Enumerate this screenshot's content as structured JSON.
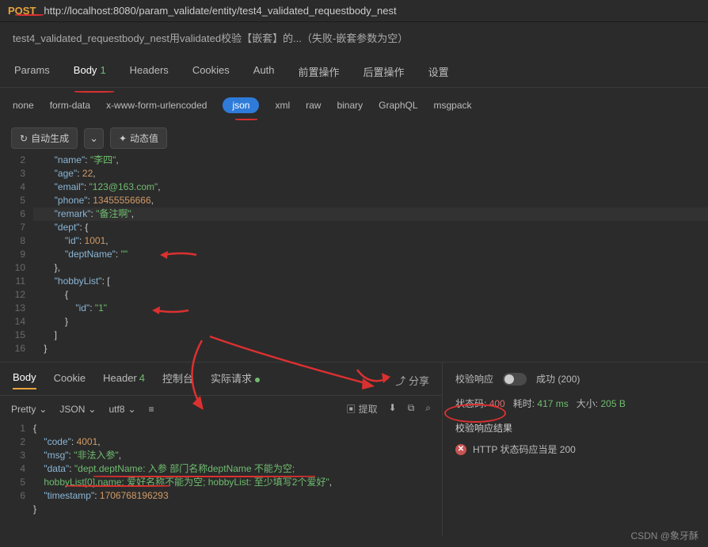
{
  "request": {
    "method": "POST",
    "url": "http://localhost:8080/param_validate/entity/test4_validated_requestbody_nest",
    "description": "test4_validated_requestbody_nest用validated校验【嵌套】的...（失败-嵌套参数为空）"
  },
  "tabs1": {
    "items": [
      "Params",
      "Body",
      "Headers",
      "Cookies",
      "Auth",
      "前置操作",
      "后置操作",
      "设置"
    ],
    "active": "Body",
    "body_badge": "1"
  },
  "types": {
    "items": [
      "none",
      "form-data",
      "x-www-form-urlencoded",
      "json",
      "xml",
      "raw",
      "binary",
      "GraphQL",
      "msgpack"
    ],
    "active": "json"
  },
  "toolbar": {
    "auto": "自动生成",
    "dyn": "动态值"
  },
  "req_body": {
    "lines": [
      {
        "no": "2",
        "ind": 2,
        "tokens": [
          [
            "k",
            "\"name\""
          ],
          [
            "p",
            ": "
          ],
          [
            "s",
            "\"李四\""
          ],
          [
            "p",
            ","
          ]
        ]
      },
      {
        "no": "3",
        "ind": 2,
        "tokens": [
          [
            "k",
            "\"age\""
          ],
          [
            "p",
            ": "
          ],
          [
            "n",
            "22"
          ],
          [
            "p",
            ","
          ]
        ]
      },
      {
        "no": "4",
        "ind": 2,
        "tokens": [
          [
            "k",
            "\"email\""
          ],
          [
            "p",
            ": "
          ],
          [
            "s",
            "\"123@163.com\""
          ],
          [
            "p",
            ","
          ]
        ]
      },
      {
        "no": "5",
        "ind": 2,
        "tokens": [
          [
            "k",
            "\"phone\""
          ],
          [
            "p",
            ": "
          ],
          [
            "n",
            "13455556666"
          ],
          [
            "p",
            ","
          ]
        ]
      },
      {
        "no": "6",
        "ind": 2,
        "hl": true,
        "tokens": [
          [
            "k",
            "\"remark\""
          ],
          [
            "p",
            ": "
          ],
          [
            "s",
            "\"备注啊\""
          ],
          [
            "p",
            ","
          ]
        ]
      },
      {
        "no": "7",
        "ind": 2,
        "tokens": [
          [
            "k",
            "\"dept\""
          ],
          [
            "p",
            ": {"
          ]
        ]
      },
      {
        "no": "8",
        "ind": 3,
        "tokens": [
          [
            "k",
            "\"id\""
          ],
          [
            "p",
            ": "
          ],
          [
            "n",
            "1001"
          ],
          [
            "p",
            ","
          ]
        ]
      },
      {
        "no": "9",
        "ind": 3,
        "tokens": [
          [
            "k",
            "\"deptName\""
          ],
          [
            "p",
            ": "
          ],
          [
            "s",
            "\"\""
          ]
        ]
      },
      {
        "no": "10",
        "ind": 2,
        "tokens": [
          [
            "p",
            "},"
          ]
        ]
      },
      {
        "no": "11",
        "ind": 2,
        "tokens": [
          [
            "k",
            "\"hobbyList\""
          ],
          [
            "p",
            ": ["
          ]
        ]
      },
      {
        "no": "12",
        "ind": 3,
        "tokens": [
          [
            "p",
            "{"
          ]
        ]
      },
      {
        "no": "13",
        "ind": 4,
        "tokens": [
          [
            "k",
            "\"id\""
          ],
          [
            "p",
            ": "
          ],
          [
            "s",
            "\"1\""
          ]
        ]
      },
      {
        "no": "14",
        "ind": 3,
        "tokens": [
          [
            "p",
            "}"
          ]
        ]
      },
      {
        "no": "15",
        "ind": 2,
        "tokens": [
          [
            "p",
            "]"
          ]
        ]
      },
      {
        "no": "16",
        "ind": 1,
        "tokens": [
          [
            "p",
            "}"
          ]
        ]
      }
    ]
  },
  "resp_tabs": {
    "items": [
      {
        "label": "Body"
      },
      {
        "label": "Cookie"
      },
      {
        "label": "Header",
        "badge": "4"
      },
      {
        "label": "控制台"
      },
      {
        "label": "实际请求",
        "dot": true
      }
    ],
    "active": "Body",
    "share": "分享"
  },
  "resp_toolbar": {
    "pretty": "Pretty",
    "format": "JSON",
    "enc": "utf8",
    "extract": "提取"
  },
  "resp_body": {
    "lines": [
      {
        "no": "1",
        "ind": 0,
        "tokens": [
          [
            "p",
            "{"
          ]
        ]
      },
      {
        "no": "2",
        "ind": 1,
        "tokens": [
          [
            "k",
            "\"code\""
          ],
          [
            "p",
            ": "
          ],
          [
            "n",
            "4001"
          ],
          [
            "p",
            ","
          ]
        ]
      },
      {
        "no": "3",
        "ind": 1,
        "tokens": [
          [
            "k",
            "\"msg\""
          ],
          [
            "p",
            ": "
          ],
          [
            "s",
            "\"非法入参\""
          ],
          [
            "p",
            ","
          ]
        ]
      },
      {
        "no": "4",
        "ind": 1,
        "tokens": [
          [
            "k",
            "\"data\""
          ],
          [
            "p",
            ": "
          ],
          [
            "s",
            "\"dept.deptName: 入参 部门名称deptName 不能为空; \nhobbyList[0].name: 爱好名称不能为空; hobbyList: 至少填写2个爱好\""
          ],
          [
            "p",
            ","
          ]
        ]
      },
      {
        "no": "5",
        "ind": 1,
        "tokens": [
          [
            "k",
            "\"timestamp\""
          ],
          [
            "p",
            ": "
          ],
          [
            "n",
            "1706768196293"
          ]
        ]
      },
      {
        "no": "6",
        "ind": 0,
        "tokens": [
          [
            "p",
            "}"
          ]
        ]
      }
    ]
  },
  "verify": {
    "label": "校验响应",
    "success": "成功 (200)",
    "stats": {
      "code_label": "状态码:",
      "code": "400",
      "time_label": "耗时:",
      "time": "417 ms",
      "size_label": "大小:",
      "size": "205 B"
    },
    "result_title": "校验响应结果",
    "result_item": "HTTP 状态码应当是 200"
  },
  "watermark": "CSDN @象牙酥"
}
